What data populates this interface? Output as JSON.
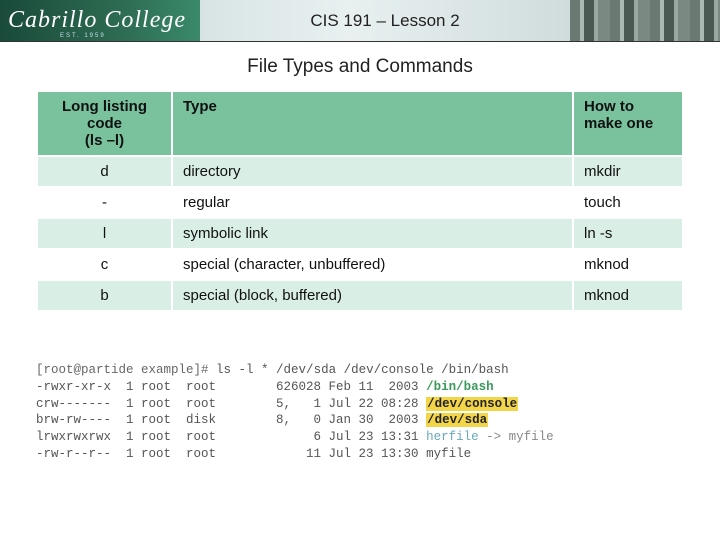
{
  "banner": {
    "logo": "Cabrillo College",
    "est": "EST. 1959",
    "title": "CIS 191 – Lesson 2"
  },
  "section_title": "File Types and Commands",
  "table": {
    "headers": {
      "code": "Long listing code\n(ls –l)",
      "type": "Type",
      "make": "How to make one"
    },
    "rows": [
      {
        "code": "d",
        "type": "directory",
        "make": "mkdir"
      },
      {
        "code": "-",
        "type": "regular",
        "make": "touch"
      },
      {
        "code": "l",
        "type": "symbolic link",
        "make": "ln -s"
      },
      {
        "code": "c",
        "type": "special (character, unbuffered)",
        "make": "mknod"
      },
      {
        "code": "b",
        "type": "special (block, buffered)",
        "make": "mknod"
      }
    ]
  },
  "terminal": {
    "prompt": "[root@partide example]#",
    "command": "ls -l * /dev/sda /dev/console /bin/bash",
    "lines": [
      {
        "perm": "-rwxr-xr-x",
        "n": "1",
        "u": "root",
        "g": "root",
        "size": "626028",
        "date": "Feb 11  2003",
        "name": "/bin/bash",
        "style": "green"
      },
      {
        "perm": "crw-------",
        "n": "1",
        "u": "root",
        "g": "root",
        "size": "5,   1",
        "date": "Jul 22 08:28",
        "name": "/dev/console",
        "style": "yellowbg"
      },
      {
        "perm": "brw-rw----",
        "n": "1",
        "u": "root",
        "g": "disk",
        "size": "8,   0",
        "date": "Jan 30  2003",
        "name": "/dev/sda",
        "style": "yellowbg"
      },
      {
        "perm": "lrwxrwxrwx",
        "n": "1",
        "u": "root",
        "g": "root",
        "size": "6",
        "date": "Jul 23 13:31",
        "name": "herfile",
        "style": "cyan",
        "target": "myfile"
      },
      {
        "perm": "-rw-r--r--",
        "n": "1",
        "u": "root",
        "g": "root",
        "size": "11",
        "date": "Jul 23 13:30",
        "name": "myfile",
        "style": "plain"
      }
    ]
  }
}
